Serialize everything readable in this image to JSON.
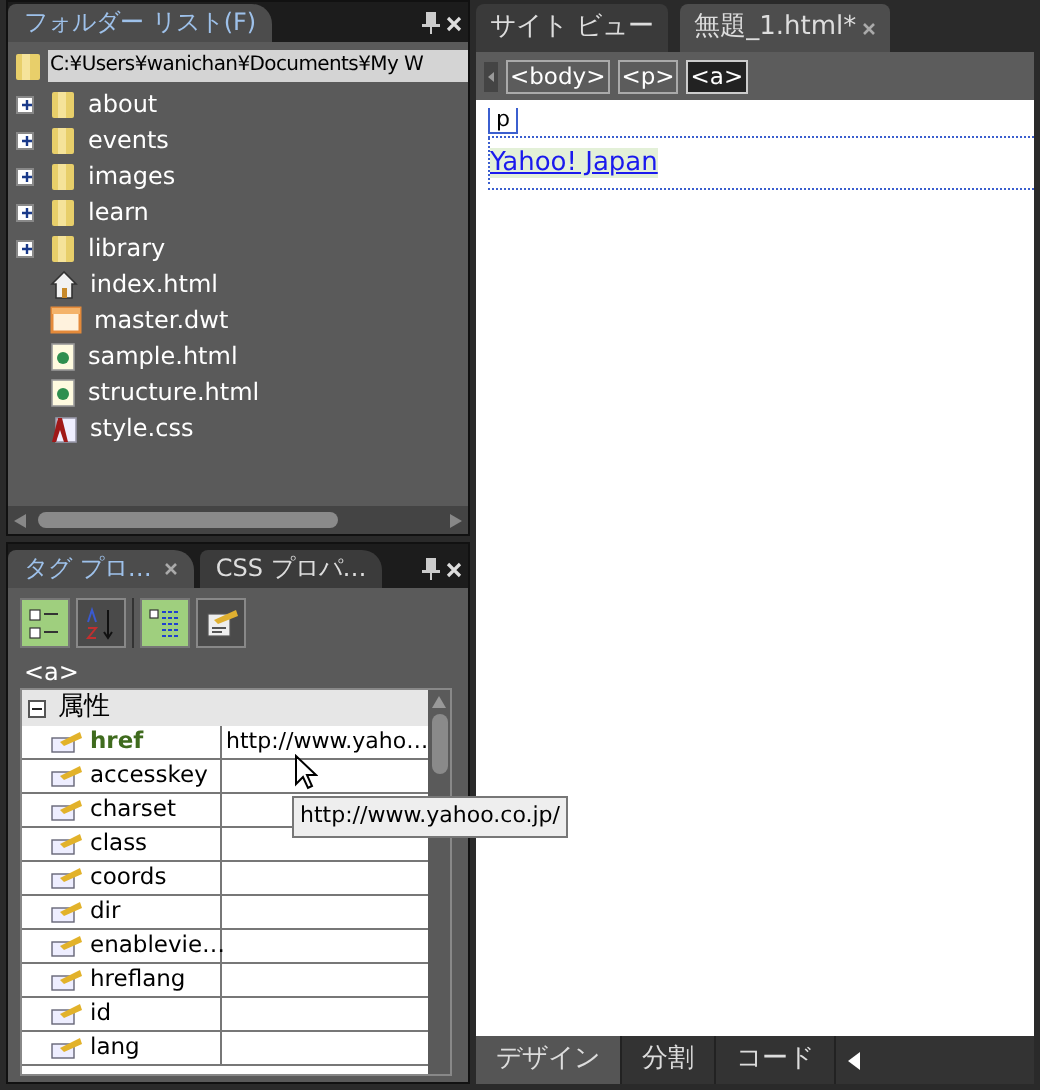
{
  "folder_list": {
    "title": "フォルダー リスト(F)",
    "path": "C:¥Users¥wanichan¥Documents¥My W",
    "items": [
      {
        "name": "about",
        "kind": "folder",
        "expandable": true
      },
      {
        "name": "events",
        "kind": "folder",
        "expandable": true
      },
      {
        "name": "images",
        "kind": "folder",
        "expandable": true
      },
      {
        "name": "learn",
        "kind": "folder",
        "expandable": true
      },
      {
        "name": "library",
        "kind": "folder",
        "expandable": true
      },
      {
        "name": "index.html",
        "kind": "home",
        "expandable": false
      },
      {
        "name": "master.dwt",
        "kind": "template",
        "expandable": false
      },
      {
        "name": "sample.html",
        "kind": "page",
        "expandable": false
      },
      {
        "name": "structure.html",
        "kind": "page",
        "expandable": false
      },
      {
        "name": "style.css",
        "kind": "css",
        "expandable": false
      }
    ]
  },
  "properties_panel": {
    "tabs": [
      {
        "label": "タグ プロ…",
        "selected": true
      },
      {
        "label": "CSS プロパ…",
        "selected": false
      }
    ],
    "toolbar": [
      {
        "kind": "categorized",
        "selected": true
      },
      {
        "kind": "sorted",
        "selected": false
      },
      {
        "kind": "set-first",
        "selected": true
      },
      {
        "kind": "tag-editor",
        "selected": false
      }
    ],
    "current_tag": "<a>",
    "section": {
      "label": "属性",
      "expanded": true
    },
    "rows": [
      {
        "name": "href",
        "value": "http://www.yaho…",
        "set": true
      },
      {
        "name": "accesskey",
        "set": false
      },
      {
        "name": "charset",
        "set": false
      },
      {
        "name": "class",
        "set": false
      },
      {
        "name": "coords",
        "set": false
      },
      {
        "name": "dir",
        "set": false
      },
      {
        "name": "enablevie…",
        "set": false
      },
      {
        "name": "hreflang",
        "set": false
      },
      {
        "name": "id",
        "set": false
      },
      {
        "name": "lang",
        "set": false
      }
    ],
    "tooltip": "http://www.yahoo.co.jp/"
  },
  "document": {
    "tabs": [
      {
        "label": "サイト ビュー",
        "selected": false
      },
      {
        "label": "無題_1.html*",
        "selected": true
      }
    ],
    "breadcrumb": [
      {
        "label": "<body>",
        "selected": false
      },
      {
        "label": "<p>",
        "selected": false
      },
      {
        "label": "<a>",
        "selected": true
      }
    ],
    "block_tag": "p",
    "link_text": "Yahoo! Japan",
    "view_tabs": [
      {
        "label": "デザイン",
        "selected": true
      },
      {
        "label": "分割",
        "selected": false
      },
      {
        "label": "コード",
        "selected": false
      }
    ]
  }
}
